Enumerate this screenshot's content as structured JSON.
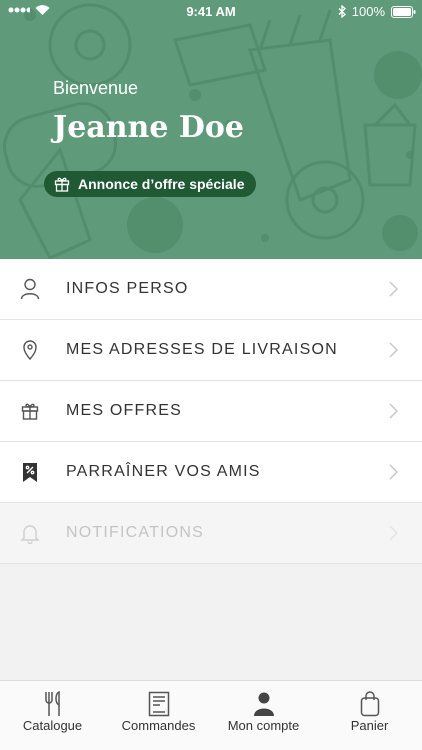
{
  "status_bar": {
    "time": "9:41 AM",
    "battery": "100%"
  },
  "header": {
    "welcome": "Bienvenue",
    "user_name": "Jeanne Doe",
    "offer_button_label": "Annonce d’offre spéciale"
  },
  "menu": [
    {
      "label": "INFOS PERSO",
      "icon": "person-icon",
      "enabled": true
    },
    {
      "label": "MES ADRESSES DE LIVRAISON",
      "icon": "location-pin-icon",
      "enabled": true
    },
    {
      "label": "MES OFFRES",
      "icon": "gift-icon",
      "enabled": true
    },
    {
      "label": "PARRAÎNER VOS AMIS",
      "icon": "referral-tag-icon",
      "enabled": true
    },
    {
      "label": "NOTIFICATIONS",
      "icon": "bell-icon",
      "enabled": false
    }
  ],
  "tabbar": [
    {
      "label": "Catalogue",
      "icon": "fork-knife-icon",
      "active": false
    },
    {
      "label": "Commandes",
      "icon": "receipt-icon",
      "active": false
    },
    {
      "label": "Mon compte",
      "icon": "person-filled-icon",
      "active": true
    },
    {
      "label": "Panier",
      "icon": "shopping-bag-icon",
      "active": false
    }
  ],
  "colors": {
    "header_bg": "#5f9b7a",
    "button_bg": "#1f5a34",
    "text": "#333333",
    "disabled": "#c4c4c4"
  }
}
